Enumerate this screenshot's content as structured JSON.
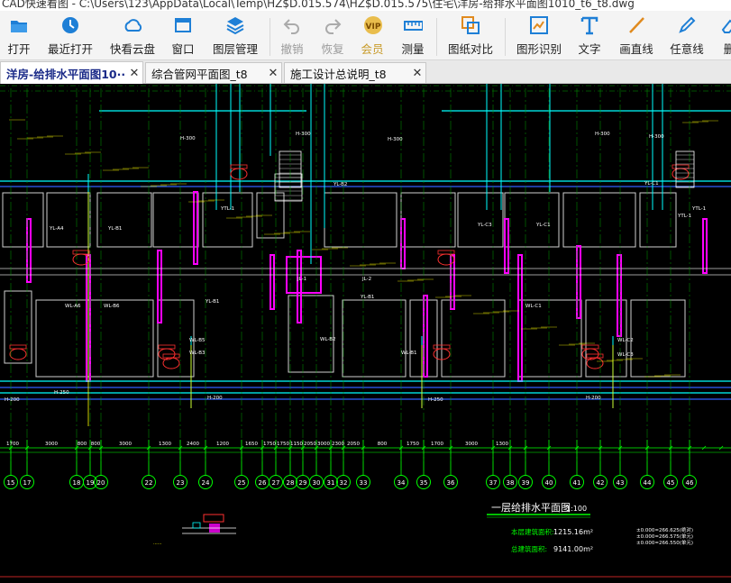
{
  "window": {
    "title": "CAD快速看图 - C:\\Users\\123\\AppData\\Local\\Temp\\HZ$D.015.574\\HZ$D.015.575\\住宅\\洋房-给排水平面图1010_t6_t8.dwg"
  },
  "toolbar": {
    "open": "打开",
    "recent": "最近打开",
    "cloud": "快看云盘",
    "window": "窗口",
    "layers": "图层管理",
    "undo": "撤销",
    "redo": "恢复",
    "vip": "会员",
    "measure": "测量",
    "compare": "图纸对比",
    "recognize": "图形识别",
    "text": "文字",
    "line": "画直线",
    "freeline": "任意线",
    "delete": "删"
  },
  "tabs": [
    {
      "label": "洋房-给排水平面图10···",
      "close": "✕",
      "active": true
    },
    {
      "label": "综合管网平面图_t8",
      "close": "✕",
      "active": false
    },
    {
      "label": "施工设计总说明_t8",
      "close": "✕",
      "active": false
    }
  ],
  "drawing": {
    "dimensions": [
      "1700",
      "3000",
      "800",
      "800",
      "3000",
      "1300",
      "2400",
      "1200",
      "1650",
      "1750",
      "1750",
      "1150",
      "2050",
      "3000",
      "2300",
      "2050",
      "800",
      "1750",
      "1700",
      "3000",
      "1300"
    ],
    "axes": [
      "15",
      "17",
      "18",
      "19",
      "20",
      "22",
      "23",
      "24",
      "25",
      "26",
      "27",
      "28",
      "29",
      "30",
      "31",
      "32",
      "33",
      "34",
      "35",
      "36",
      "37",
      "38",
      "39",
      "40",
      "41",
      "42",
      "43",
      "44",
      "45",
      "46"
    ],
    "plan_title": "一层给排水平面图",
    "plan_scale": "1:100",
    "area_label_1": "本层建筑面积:",
    "area_value_1": "1215.16m²",
    "area_label_2": "总建筑面积:",
    "area_value_2": "9141.00m²",
    "notes": [
      "±0.000=266.625(绝对)",
      "±0.000=266.575(单元)",
      "±0.000=266.550(单元)"
    ],
    "room_labels": [
      "YL-A4",
      "YL-B1",
      "WL-A6",
      "WL-B6",
      "YL-B1",
      "WL-B5",
      "WL-B3",
      "YTL-1",
      "YL-B2",
      "YL-B1",
      "WL-B2",
      "WL-B1",
      "YTL-1",
      "YL-C3",
      "YL-C1",
      "WL-C1",
      "WL-C2",
      "WL-C3",
      "YTL-1",
      "YL-C1",
      "JL-1",
      "JL-2"
    ],
    "level_labels": [
      "H-300",
      "H-300",
      "H-300",
      "H-300",
      "H-300",
      "H-200",
      "H-250",
      "H-200",
      "H-250",
      "H-200"
    ]
  },
  "colors": {
    "background": "#000000",
    "axis_green": "#00ff00",
    "wall_magenta": "#ff00ff",
    "pipe_cyan": "#00ffff",
    "pipe_blue": "#3060ff",
    "text_white": "#ffffff",
    "text_yellow": "#ffff00",
    "fixture_red": "#ff3030",
    "toolbar_bg": "#f4f4f4",
    "tab_active_text": "#1a2a88",
    "vip_gold": "#c89b2a"
  },
  "icons": {
    "open": "folder-icon",
    "recent": "clock-icon",
    "cloud": "cloud-icon",
    "window": "window-icon",
    "layers": "layers-icon",
    "undo": "undo-icon",
    "redo": "redo-icon",
    "vip": "vip-icon",
    "measure": "ruler-icon",
    "compare": "compare-icon",
    "recognize": "shape-recognize-icon",
    "text": "text-icon",
    "line": "line-icon",
    "freeline": "pen-icon",
    "delete": "eraser-icon"
  }
}
